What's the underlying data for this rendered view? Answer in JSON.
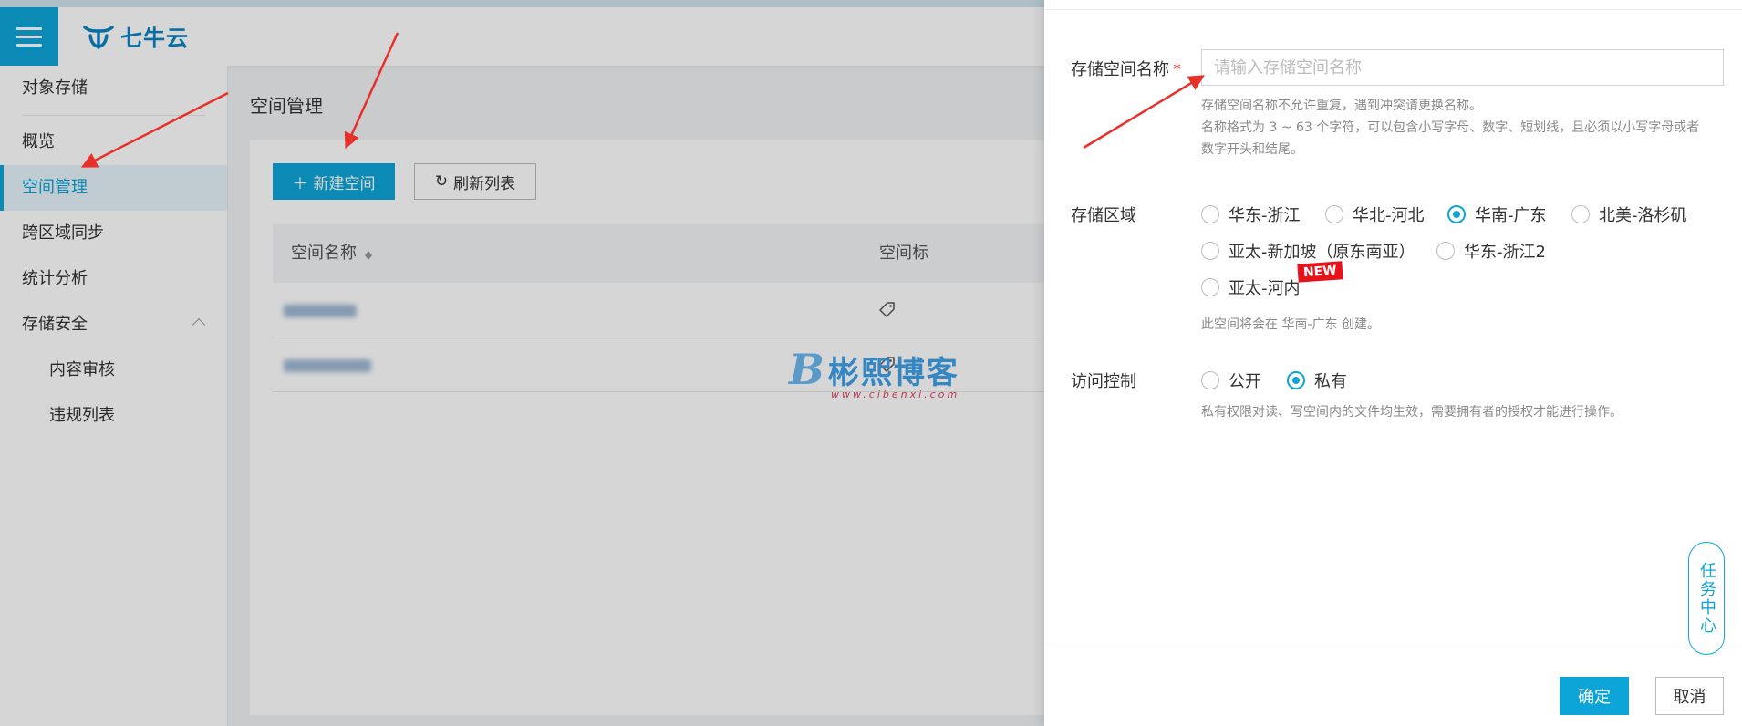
{
  "header": {
    "logo_text": "七牛云"
  },
  "sidebar": {
    "items": [
      {
        "label": "对象存储"
      },
      {
        "label": "概览"
      },
      {
        "label": "空间管理"
      },
      {
        "label": "跨区域同步"
      },
      {
        "label": "统计分析"
      },
      {
        "label": "存储安全"
      },
      {
        "label": "内容审核"
      },
      {
        "label": "违规列表"
      }
    ],
    "active": "空间管理"
  },
  "main": {
    "title": "空间管理",
    "new_button": "新建空间",
    "refresh_button": "刷新列表",
    "columns": [
      "空间名称",
      "空间标"
    ]
  },
  "watermark": {
    "text": "彬熙博客",
    "letter": "B",
    "url": "www.cibenxi.com"
  },
  "drawer": {
    "name_label": "存储空间名称",
    "required_mark": "*",
    "name_placeholder": "请输入存储空间名称",
    "name_value": "",
    "name_hints": [
      "存储空间名称不允许重复，遇到冲突请更换名称。",
      "名称格式为 3 ~ 63 个字符，可以包含小写字母、数字、短划线，且必须以小写字母或者数字开头和结尾。"
    ],
    "region_label": "存储区域",
    "regions": [
      {
        "label": "华东-浙江",
        "checked": false
      },
      {
        "label": "华北-河北",
        "checked": false
      },
      {
        "label": "华南-广东",
        "checked": true
      },
      {
        "label": "北美-洛杉矶",
        "checked": false
      },
      {
        "label": "亚太-新加坡（原东南亚）",
        "checked": false
      },
      {
        "label": "华东-浙江2",
        "checked": false
      },
      {
        "label": "亚太-河内",
        "checked": false
      }
    ],
    "new_badge": "NEW",
    "region_hint": "此空间将会在 华南-广东 创建。",
    "access_label": "访问控制",
    "access_options": [
      {
        "label": "公开",
        "checked": false
      },
      {
        "label": "私有",
        "checked": true
      }
    ],
    "access_hint": "私有权限对读、写空间内的文件均生效，需要拥有者的授权才能进行操作。",
    "task_center": "任务中心",
    "ok_button": "确定",
    "cancel_button": "取消"
  },
  "colors": {
    "accent": "#0da5d8",
    "badge": "#e8121b",
    "arrow": "#e8302a"
  }
}
